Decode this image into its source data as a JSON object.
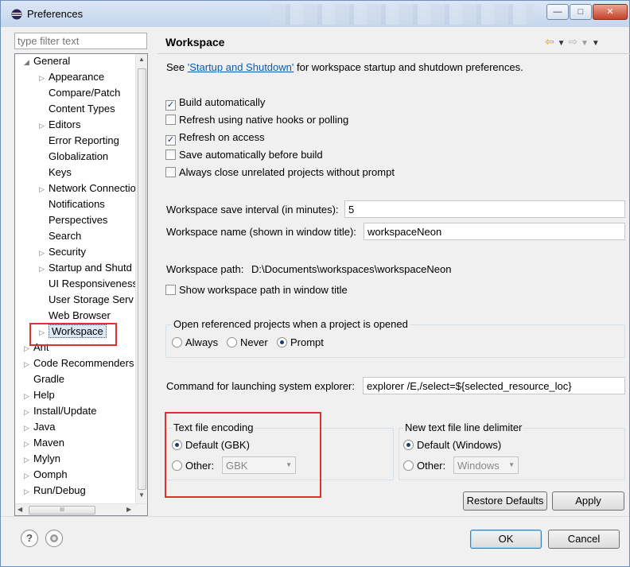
{
  "window": {
    "title": "Preferences",
    "controls": {
      "minimize": "—",
      "maximize": "□",
      "close": "✕"
    }
  },
  "filter": {
    "placeholder": "type filter text"
  },
  "tree": {
    "items": [
      {
        "label": "General",
        "twisty": "expanded"
      },
      {
        "label": "Appearance",
        "twisty": "collapsed"
      },
      {
        "label": "Compare/Patch",
        "twisty": "none"
      },
      {
        "label": "Content Types",
        "twisty": "none"
      },
      {
        "label": "Editors",
        "twisty": "collapsed"
      },
      {
        "label": "Error Reporting",
        "twisty": "none"
      },
      {
        "label": "Globalization",
        "twisty": "none"
      },
      {
        "label": "Keys",
        "twisty": "none"
      },
      {
        "label": "Network Connectio",
        "twisty": "collapsed"
      },
      {
        "label": "Notifications",
        "twisty": "none"
      },
      {
        "label": "Perspectives",
        "twisty": "none"
      },
      {
        "label": "Search",
        "twisty": "none"
      },
      {
        "label": "Security",
        "twisty": "collapsed"
      },
      {
        "label": "Startup and Shutd",
        "twisty": "collapsed"
      },
      {
        "label": "UI Responsiveness",
        "twisty": "none"
      },
      {
        "label": "User Storage Serv",
        "twisty": "none"
      },
      {
        "label": "Web Browser",
        "twisty": "none"
      },
      {
        "label": "Workspace",
        "twisty": "collapsed",
        "selected": true
      },
      {
        "label": "Ant",
        "twisty": "collapsed"
      },
      {
        "label": "Code Recommenders",
        "twisty": "collapsed"
      },
      {
        "label": "Gradle",
        "twisty": "none"
      },
      {
        "label": "Help",
        "twisty": "collapsed"
      },
      {
        "label": "Install/Update",
        "twisty": "collapsed"
      },
      {
        "label": "Java",
        "twisty": "collapsed"
      },
      {
        "label": "Maven",
        "twisty": "collapsed"
      },
      {
        "label": "Mylyn",
        "twisty": "collapsed"
      },
      {
        "label": "Oomph",
        "twisty": "collapsed"
      },
      {
        "label": "Run/Debug",
        "twisty": "collapsed"
      }
    ],
    "hscroll_grip": "III"
  },
  "page": {
    "title": "Workspace",
    "intro_prefix": "See ",
    "intro_link": "'Startup and Shutdown'",
    "intro_suffix": " for workspace startup and shutdown preferences.",
    "checkboxes": [
      {
        "label": "Build automatically",
        "checked": true
      },
      {
        "label": "Refresh using native hooks or polling",
        "checked": false
      },
      {
        "label": "Refresh on access",
        "checked": true
      },
      {
        "label": "Save automatically before build",
        "checked": false
      },
      {
        "label": "Always close unrelated projects without prompt",
        "checked": false
      }
    ],
    "save_interval": {
      "label": "Workspace save interval (in minutes):",
      "value": "5"
    },
    "workspace_name": {
      "label": "Workspace name (shown in window title):",
      "value": "workspaceNeon"
    },
    "workspace_path": {
      "label": "Workspace path:",
      "value": "D:\\Documents\\workspaces\\workspaceNeon"
    },
    "show_path_checkbox": {
      "label": "Show workspace path in window title",
      "checked": false
    },
    "open_referenced": {
      "title": "Open referenced projects when a project is opened",
      "options": [
        "Always",
        "Never",
        "Prompt"
      ],
      "selected": "Prompt"
    },
    "explorer_command": {
      "label": "Command for launching system explorer:",
      "value": "explorer /E,/select=${selected_resource_loc}"
    },
    "encoding": {
      "title": "Text file encoding",
      "default_label": "Default (GBK)",
      "other_label": "Other:",
      "other_value": "GBK",
      "selected": "default"
    },
    "line_delimiter": {
      "title": "New text file line delimiter",
      "default_label": "Default (Windows)",
      "other_label": "Other:",
      "other_value": "Windows",
      "selected": "default"
    },
    "restore_defaults": "Restore Defaults",
    "apply": "Apply"
  },
  "footer": {
    "help_glyph": "?",
    "ok": "OK",
    "cancel": "Cancel"
  },
  "colors": {
    "highlight_box": "#e0312d",
    "link": "#0b5bb5",
    "title_bar": "#c4d6ec"
  },
  "icons": [
    "eclipse-app-icon",
    "back-arrow-icon",
    "forward-arrow-icon",
    "view-menu-icon",
    "help-icon",
    "import-export-icon"
  ]
}
